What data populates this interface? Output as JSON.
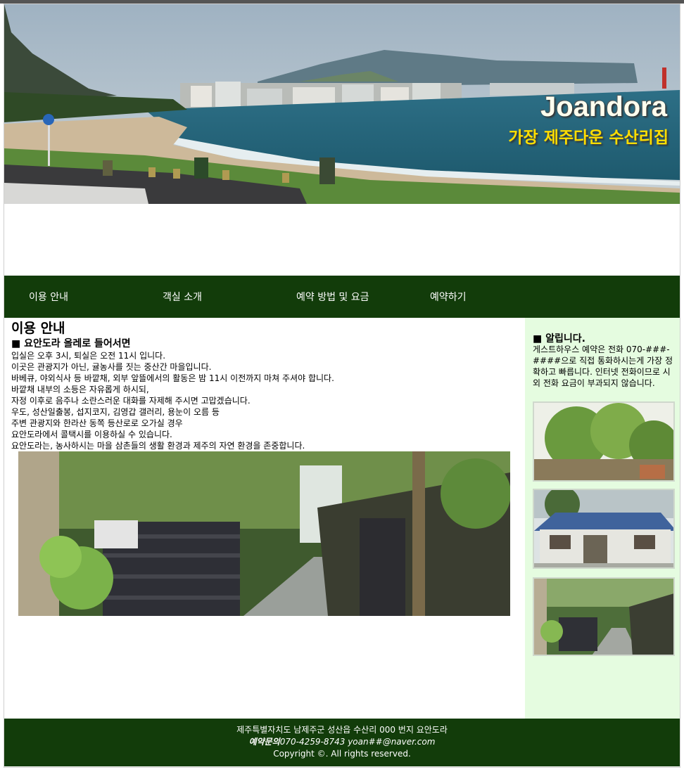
{
  "hero": {
    "title": "Joandora",
    "subtitle": "가장 제주다운 수산리집"
  },
  "nav": {
    "items": [
      {
        "label": "이용 안내"
      },
      {
        "label": "객실 소개"
      },
      {
        "label": "예약 방법 및 요금"
      },
      {
        "label": "예약하기"
      }
    ]
  },
  "main": {
    "heading": "이용 안내",
    "subheading": "■ 요안도라 올레로 들어서면",
    "lines": [
      "입실은 오후 3시, 퇴실은 오전 11시 입니다.",
      "이곳은 관광지가 아닌, 귤농사를 짓는 중산간 마을입니다.",
      "바베큐, 야외식사 등 바깥채, 외부 앞뜰에서의 활동은 밤 11시 이전까지 마쳐 주셔야 합니다.",
      "바깥채 내부의 소등은 자유롭게 하시되,",
      "자정 이후로 음주나 소란스러운 대화를 자제해 주시면 고맙겠습니다.",
      "우도, 성산일출봉, 섭지코지, 김영갑 갤러리, 용눈이 오름 등",
      "주변 관광지와 한라산 동쪽 등산로로 오가실 경우",
      "요안도라에서 콜택시를 이용하실 수 있습니다.",
      "요안도라는, 농사하시는 마을 삼촌들의 생활 환경과 제주의 자연 환경을 존중합니다."
    ]
  },
  "aside": {
    "heading": "■ 알립니다.",
    "text": "게스트하우스 예약은 전화 070-###-####으로 직접 통화하시는게 가장 정확하고 빠릅니다. 인터넷 전화이므로 시외 전화 요금이 부과되지 않습니다."
  },
  "footer": {
    "address": "제주특별자치도 남제주군 성산읍 수산리 000 번지 요안도라",
    "contact_label": "예약문의",
    "contact_value": "070-4259-8743 yoan##@naver.com",
    "copyright": "Copyright ©. All rights reserved."
  },
  "colors": {
    "nav_bg": "#123c0a",
    "aside_bg": "#e5fce0",
    "hero_title": "#ffffee",
    "hero_subtitle": "#ffdd00"
  }
}
